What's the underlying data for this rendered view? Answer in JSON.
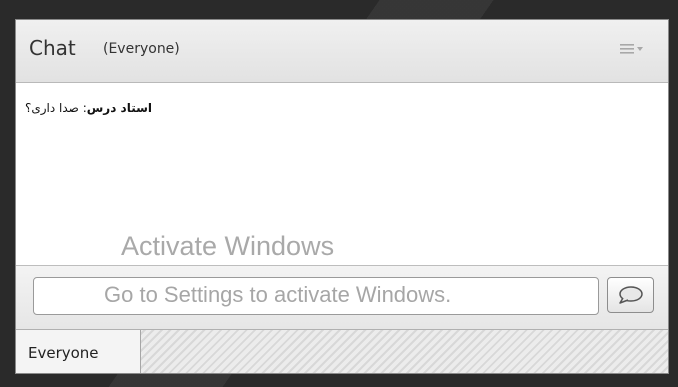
{
  "header": {
    "title": "Chat",
    "subtitle": "(Everyone)",
    "menu_icon": "list-menu-icon"
  },
  "messages": [
    {
      "sender": "استاد درس",
      "text": "صدا داری؟"
    }
  ],
  "watermark": {
    "title": "Activate Windows",
    "subtitle": "Go to Settings to activate Windows."
  },
  "input": {
    "value": "",
    "send_icon": "speech-bubble-icon"
  },
  "tabs": [
    {
      "label": "Everyone",
      "active": true
    }
  ]
}
